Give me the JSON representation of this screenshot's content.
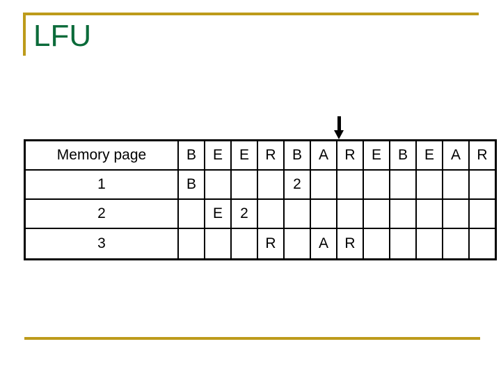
{
  "slide": {
    "title": "LFU",
    "accent_color": "#BD9B1B",
    "title_color": "#0B6B3A",
    "background": "#ffffff"
  },
  "annotation": {
    "arrow_icon": "arrow-down-icon",
    "arrow_color": "#000000",
    "points_at_column_index": 7,
    "points_at_reference": "R"
  },
  "table": {
    "header": {
      "label": "Memory page",
      "reference_string": [
        "B",
        "E",
        "E",
        "R",
        "B",
        "A",
        "R",
        "E",
        "B",
        "E",
        "A",
        "R"
      ]
    },
    "colors": {
      "page_letter": "#CC88DD",
      "fault_count": "#A41B2B",
      "text": "#000000",
      "border": "#000000"
    },
    "rows": [
      {
        "label": "1",
        "cells": [
          {
            "text": "B",
            "kind": "purple"
          },
          {
            "text": "",
            "kind": "empty"
          },
          {
            "text": "",
            "kind": "empty"
          },
          {
            "text": "",
            "kind": "empty"
          },
          {
            "text": "2",
            "kind": "red"
          },
          {
            "text": "",
            "kind": "empty"
          },
          {
            "text": "",
            "kind": "empty"
          },
          {
            "text": "",
            "kind": "empty"
          },
          {
            "text": "",
            "kind": "empty"
          },
          {
            "text": "",
            "kind": "empty"
          },
          {
            "text": "",
            "kind": "empty"
          },
          {
            "text": "",
            "kind": "empty"
          }
        ]
      },
      {
        "label": "2",
        "cells": [
          {
            "text": "",
            "kind": "empty"
          },
          {
            "text": "E",
            "kind": "purple"
          },
          {
            "text": "2",
            "kind": "red"
          },
          {
            "text": "",
            "kind": "empty"
          },
          {
            "text": "",
            "kind": "empty"
          },
          {
            "text": "",
            "kind": "empty"
          },
          {
            "text": "",
            "kind": "empty"
          },
          {
            "text": "",
            "kind": "empty"
          },
          {
            "text": "",
            "kind": "empty"
          },
          {
            "text": "",
            "kind": "empty"
          },
          {
            "text": "",
            "kind": "empty"
          },
          {
            "text": "",
            "kind": "empty"
          }
        ]
      },
      {
        "label": "3",
        "cells": [
          {
            "text": "",
            "kind": "empty"
          },
          {
            "text": "",
            "kind": "empty"
          },
          {
            "text": "",
            "kind": "empty"
          },
          {
            "text": "R",
            "kind": "purple"
          },
          {
            "text": "",
            "kind": "empty"
          },
          {
            "text": "A",
            "kind": "purple"
          },
          {
            "text": "R",
            "kind": "purple"
          },
          {
            "text": "",
            "kind": "empty"
          },
          {
            "text": "",
            "kind": "empty"
          },
          {
            "text": "",
            "kind": "empty"
          },
          {
            "text": "",
            "kind": "empty"
          },
          {
            "text": "",
            "kind": "empty"
          }
        ]
      }
    ]
  }
}
